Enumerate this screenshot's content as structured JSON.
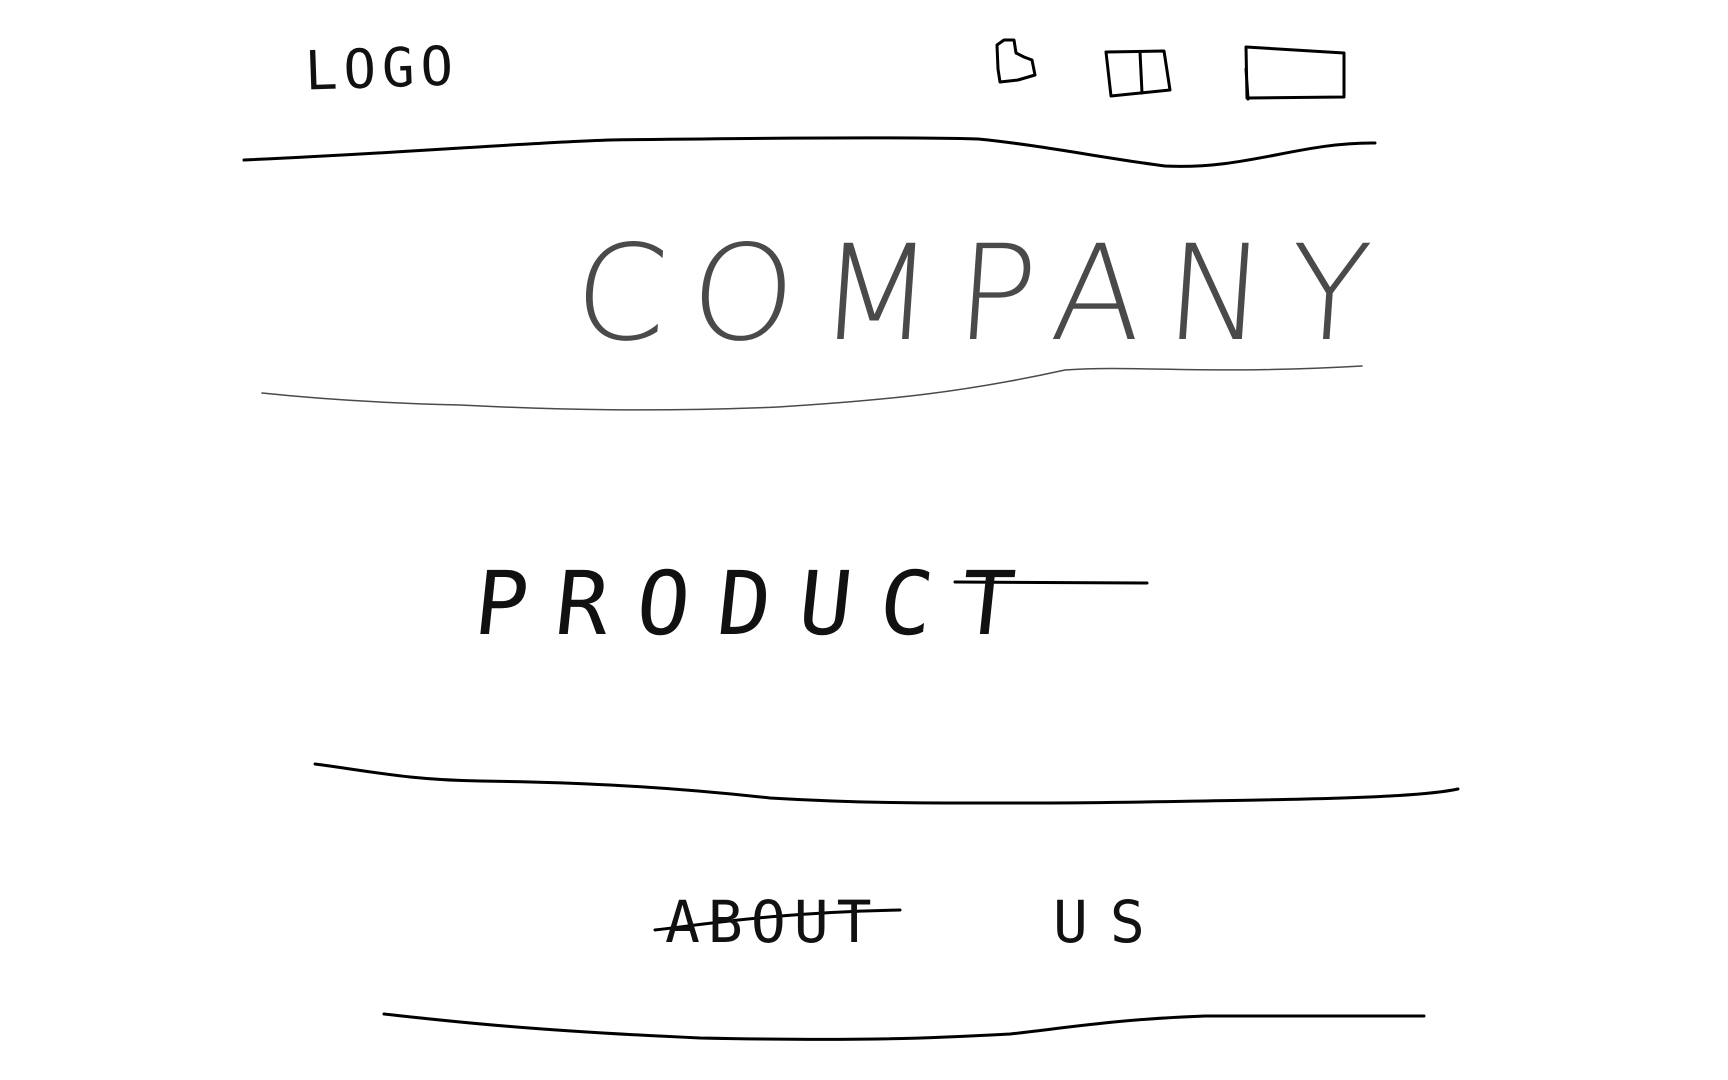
{
  "header": {
    "logo_text": "LOGO",
    "icons": [
      "header-icon-1",
      "header-icon-2",
      "header-icon-3"
    ]
  },
  "hero": {
    "title": "COMPANY"
  },
  "sections": {
    "product": "PRODUCT",
    "about_us": {
      "about": "ABOUT",
      "us": "US"
    }
  },
  "colors": {
    "ink": "#000000",
    "light_ink": "#4a4a4a",
    "background": "#ffffff"
  }
}
